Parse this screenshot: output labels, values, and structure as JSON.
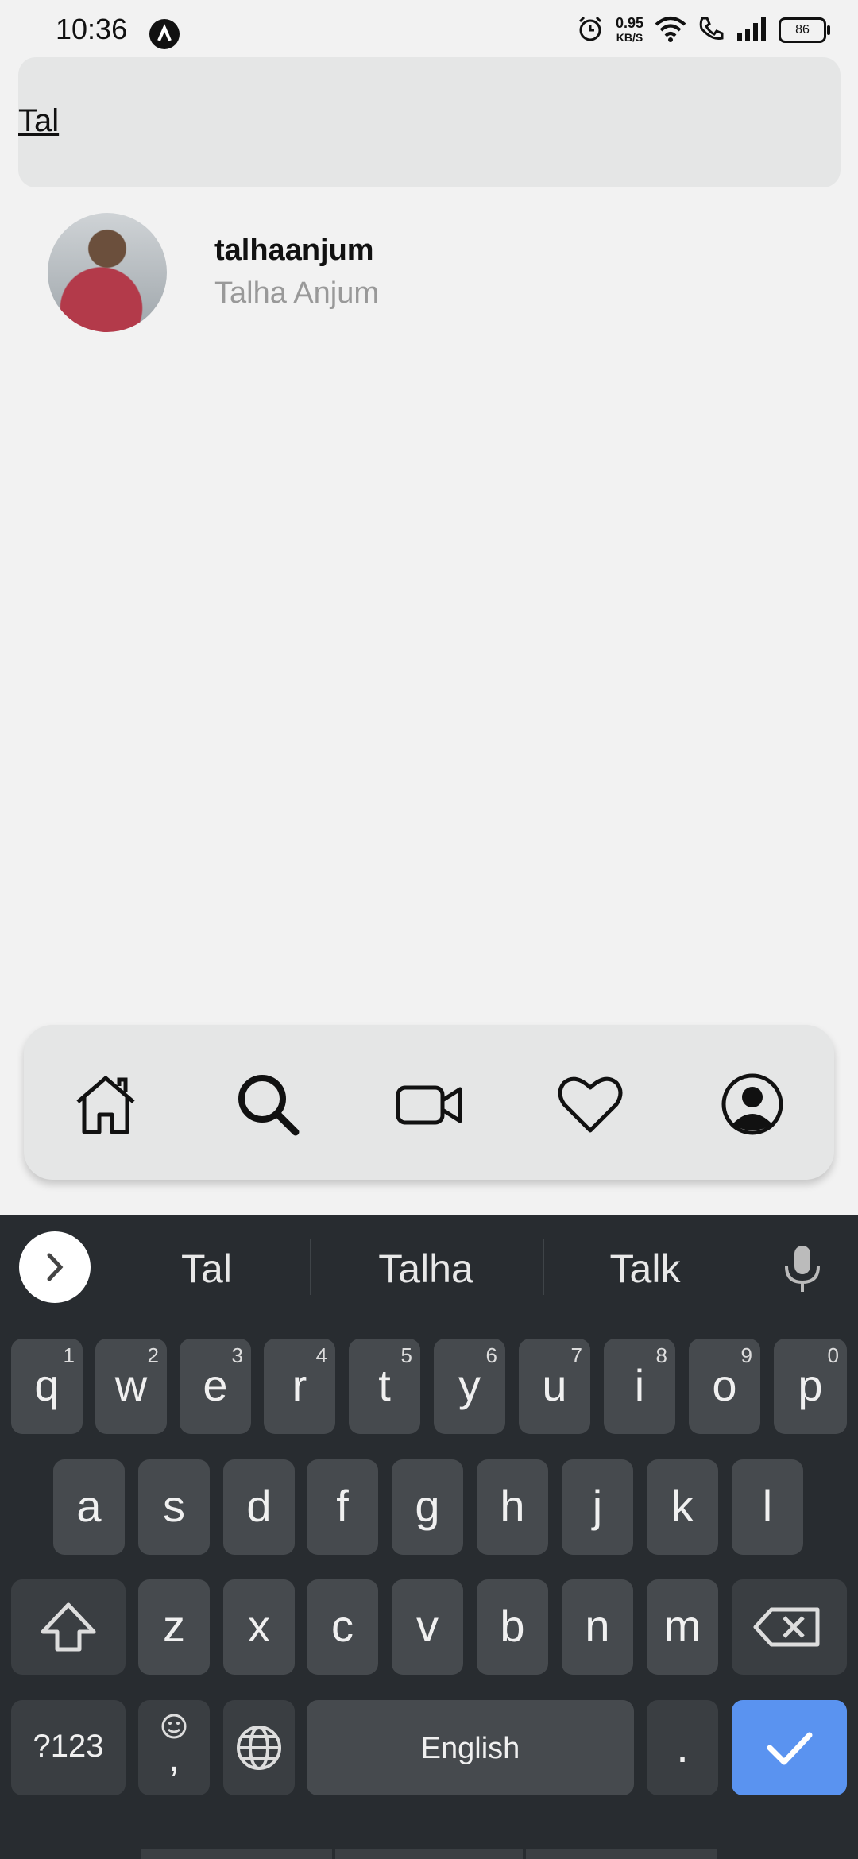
{
  "status_bar": {
    "time": "10:36",
    "net_speed": "0.95",
    "net_unit": "KB/S",
    "battery": "86"
  },
  "search": {
    "value": "Tal"
  },
  "results": [
    {
      "username": "talhaanjum",
      "full_name": "Talha Anjum"
    }
  ],
  "bottom_nav": {
    "items": [
      "home-icon",
      "search-icon",
      "video-icon",
      "heart-icon",
      "profile-icon"
    ],
    "active": "search-icon"
  },
  "keyboard": {
    "suggestions": [
      "Tal",
      "Talha",
      "Talk"
    ],
    "row1": [
      {
        "k": "q",
        "n": "1"
      },
      {
        "k": "w",
        "n": "2"
      },
      {
        "k": "e",
        "n": "3"
      },
      {
        "k": "r",
        "n": "4"
      },
      {
        "k": "t",
        "n": "5"
      },
      {
        "k": "y",
        "n": "6"
      },
      {
        "k": "u",
        "n": "7"
      },
      {
        "k": "i",
        "n": "8"
      },
      {
        "k": "o",
        "n": "9"
      },
      {
        "k": "p",
        "n": "0"
      }
    ],
    "row2": [
      "a",
      "s",
      "d",
      "f",
      "g",
      "h",
      "j",
      "k",
      "l"
    ],
    "row3": [
      "z",
      "x",
      "c",
      "v",
      "b",
      "n",
      "m"
    ],
    "symbols_label": "?123",
    "comma_label": ",",
    "space_label": "English",
    "period_label": ".",
    "accent_color": "#5a93f0"
  }
}
